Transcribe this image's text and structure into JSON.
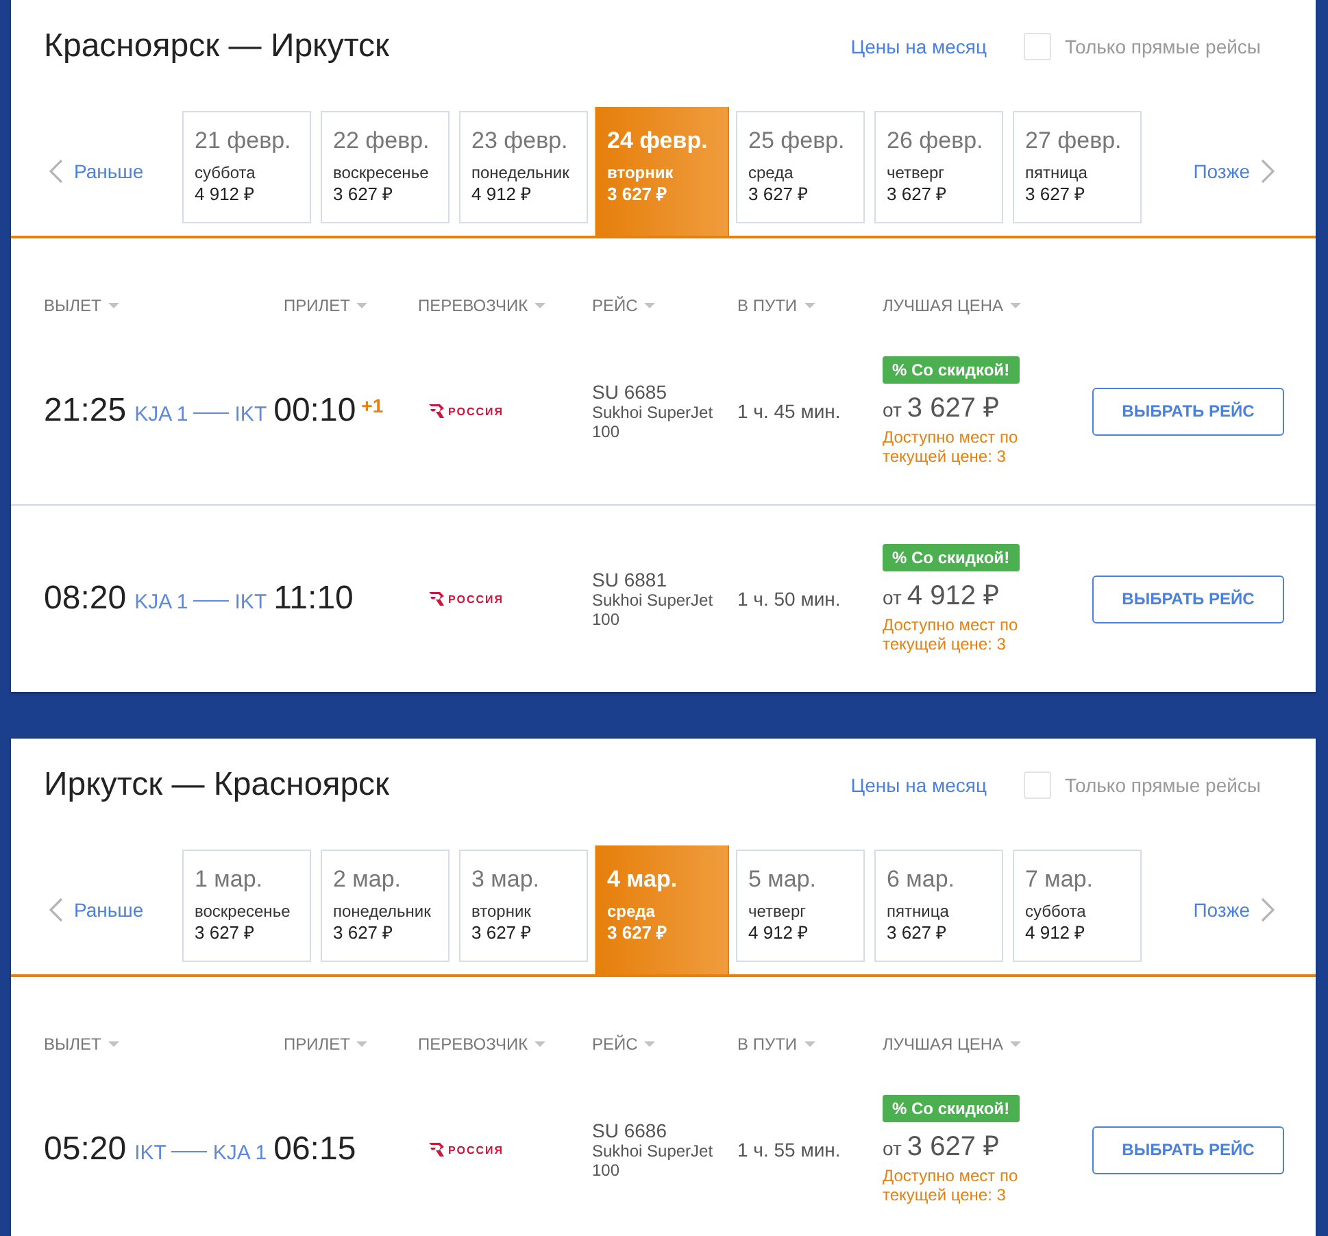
{
  "searches": [
    {
      "title": "Красноярск — Иркутск",
      "month_link": "Цены на месяц",
      "direct_only": {
        "label": "Только прямые рейсы",
        "checked": false
      },
      "earlier": "Раньше",
      "later": "Позже",
      "dates": [
        {
          "date": "21 февр.",
          "weekday": "суббота",
          "price": "4 912 ₽",
          "selected": false
        },
        {
          "date": "22 февр.",
          "weekday": "воскресенье",
          "price": "3 627 ₽",
          "selected": false
        },
        {
          "date": "23 февр.",
          "weekday": "понедельник",
          "price": "4 912 ₽",
          "selected": false
        },
        {
          "date": "24 февр.",
          "weekday": "вторник",
          "price": "3 627 ₽",
          "selected": true
        },
        {
          "date": "25 февр.",
          "weekday": "среда",
          "price": "3 627 ₽",
          "selected": false
        },
        {
          "date": "26 февр.",
          "weekday": "четверг",
          "price": "3 627 ₽",
          "selected": false
        },
        {
          "date": "27 февр.",
          "weekday": "пятница",
          "price": "3 627 ₽",
          "selected": false
        }
      ],
      "columns": [
        "ВЫЛЕТ",
        "ПРИЛЕТ",
        "ПЕРЕВОЗЧИК",
        "РЕЙС",
        "В ПУТИ",
        "ЛУЧШАЯ ЦЕНА"
      ],
      "flights": [
        {
          "departure": "21:25",
          "from": "KJA 1",
          "to": "IKT",
          "arrival": "00:10",
          "next_day": "+1",
          "carrier": "РОССИЯ",
          "flight": "SU 6685",
          "aircraft": "Sukhoi SuperJet 100",
          "duration": "1 ч. 45 мин.",
          "badge": "% Со скидкой!",
          "price_prefix": "от",
          "price": "3 627 ₽",
          "seats": "Доступно мест по текущей цене: 3",
          "button": "ВЫБРАТЬ РЕЙС"
        },
        {
          "departure": "08:20",
          "from": "KJA 1",
          "to": "IKT",
          "arrival": "11:10",
          "carrier": "РОССИЯ",
          "flight": "SU 6881",
          "aircraft": "Sukhoi SuperJet 100",
          "duration": "1 ч. 50 мин.",
          "badge": "% Со скидкой!",
          "price_prefix": "от",
          "price": "4 912 ₽",
          "seats": "Доступно мест по текущей цене: 3",
          "button": "ВЫБРАТЬ РЕЙС"
        }
      ]
    },
    {
      "title": "Иркутск — Красноярск",
      "month_link": "Цены на месяц",
      "direct_only": {
        "label": "Только прямые рейсы",
        "checked": false
      },
      "earlier": "Раньше",
      "later": "Позже",
      "dates": [
        {
          "date": "1 мар.",
          "weekday": "воскресенье",
          "price": "3 627 ₽",
          "selected": false
        },
        {
          "date": "2 мар.",
          "weekday": "понедельник",
          "price": "3 627 ₽",
          "selected": false
        },
        {
          "date": "3 мар.",
          "weekday": "вторник",
          "price": "3 627 ₽",
          "selected": false
        },
        {
          "date": "4 мар.",
          "weekday": "среда",
          "price": "3 627 ₽",
          "selected": true
        },
        {
          "date": "5 мар.",
          "weekday": "четверг",
          "price": "4 912 ₽",
          "selected": false
        },
        {
          "date": "6 мар.",
          "weekday": "пятница",
          "price": "3 627 ₽",
          "selected": false
        },
        {
          "date": "7 мар.",
          "weekday": "суббота",
          "price": "4 912 ₽",
          "selected": false
        }
      ],
      "columns": [
        "ВЫЛЕТ",
        "ПРИЛЕТ",
        "ПЕРЕВОЗЧИК",
        "РЕЙС",
        "В ПУТИ",
        "ЛУЧШАЯ ЦЕНА"
      ],
      "flights": [
        {
          "departure": "05:20",
          "from": "IKT",
          "to": "KJA 1",
          "arrival": "06:15",
          "carrier": "РОССИЯ",
          "flight": "SU 6686",
          "aircraft": "Sukhoi SuperJet 100",
          "duration": "1 ч. 55 мин.",
          "badge": "% Со скидкой!",
          "price_prefix": "от",
          "price": "3 627 ₽",
          "seats": "Доступно мест по текущей цене: 3",
          "button": "ВЫБРАТЬ РЕЙС"
        }
      ]
    }
  ]
}
